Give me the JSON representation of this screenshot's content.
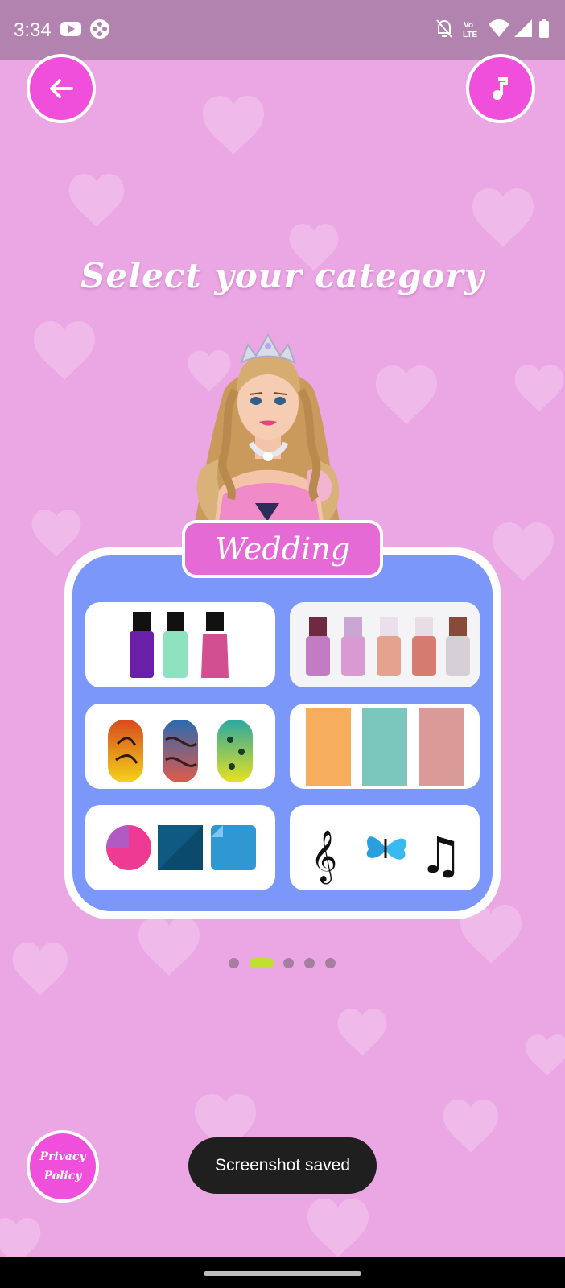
{
  "status_bar": {
    "time": "3:34",
    "left_icons": [
      "youtube-icon",
      "game-controller-icon"
    ],
    "right_icons": [
      "bell-off-icon",
      "volte-icon",
      "wifi-icon",
      "signal-icon",
      "battery-icon"
    ]
  },
  "header": {
    "back_icon": "arrow-left-icon",
    "music_icon": "music-note-icon"
  },
  "title": "Select your category",
  "category": {
    "label": "Wedding",
    "tiles": [
      {
        "name": "nail-polish-bottles",
        "icon": "nail-polish-icon"
      },
      {
        "name": "glitter-polish-bottles",
        "icon": "glitter-polish-icon"
      },
      {
        "name": "nail-patterns",
        "icon": "patterned-nails-icon"
      },
      {
        "name": "texture-swatches",
        "icon": "texture-swatch-icon"
      },
      {
        "name": "color-shapes",
        "icon": "color-shapes-icon"
      },
      {
        "name": "stickers",
        "icon": "music-butterfly-icon"
      }
    ]
  },
  "pager": {
    "count": 5,
    "active": 1
  },
  "privacy": {
    "line1": "Privacy",
    "line2": "Policy"
  },
  "toast": "Screenshot saved",
  "colors": {
    "background": "#eaa7e3",
    "accent": "#f04fdc",
    "card": "#7b97f9",
    "active_dot": "#bfe02e"
  }
}
